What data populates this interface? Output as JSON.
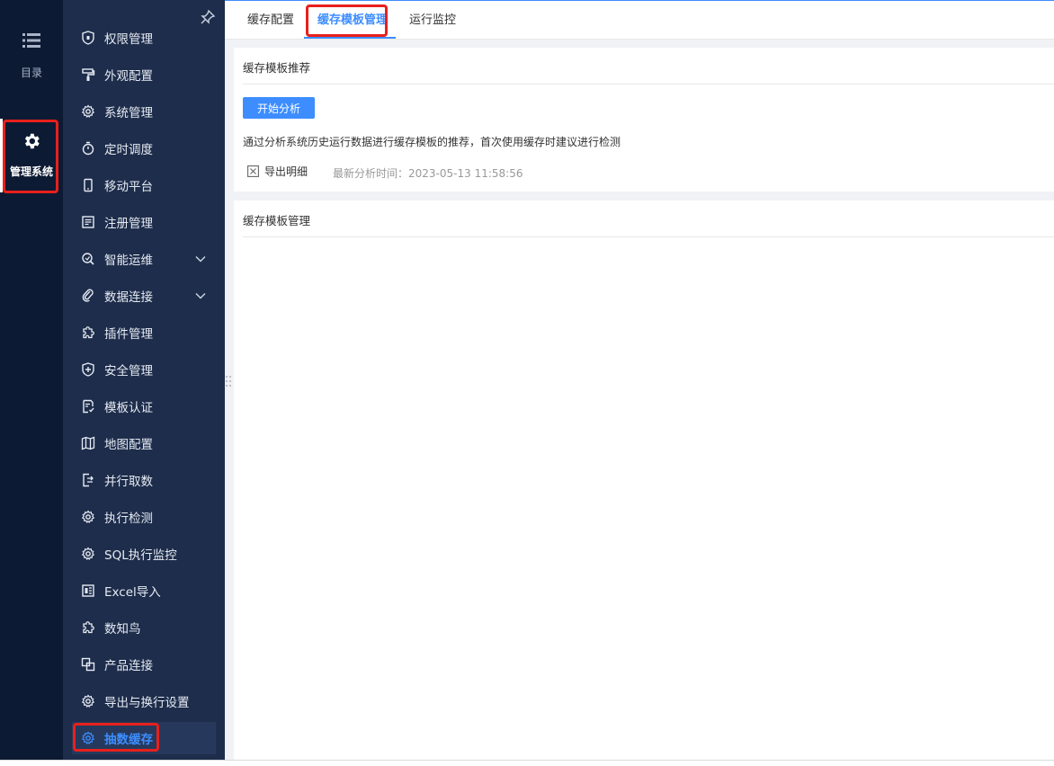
{
  "rail": {
    "catalog_label": "目录",
    "admin_label": "管理系统"
  },
  "sidebar": {
    "items": [
      {
        "label": "权限管理",
        "icon": "permission-icon"
      },
      {
        "label": "外观配置",
        "icon": "paint-roller-icon"
      },
      {
        "label": "系统管理",
        "icon": "gear-icon"
      },
      {
        "label": "定时调度",
        "icon": "timer-icon"
      },
      {
        "label": "移动平台",
        "icon": "mobile-icon"
      },
      {
        "label": "注册管理",
        "icon": "register-icon"
      },
      {
        "label": "智能运维",
        "icon": "smart-ops-icon"
      },
      {
        "label": "数据连接",
        "icon": "link-icon"
      },
      {
        "label": "插件管理",
        "icon": "puzzle-icon"
      },
      {
        "label": "安全管理",
        "icon": "shield-icon"
      },
      {
        "label": "模板认证",
        "icon": "template-cert-icon"
      },
      {
        "label": "地图配置",
        "icon": "map-icon"
      },
      {
        "label": "并行取数",
        "icon": "parallel-fetch-icon"
      },
      {
        "label": "执行检测",
        "icon": "gear-icon"
      },
      {
        "label": "SQL执行监控",
        "icon": "gear-icon"
      },
      {
        "label": "Excel导入",
        "icon": "excel-icon"
      },
      {
        "label": "数知鸟",
        "icon": "puzzle-icon"
      },
      {
        "label": "产品连接",
        "icon": "product-link-icon"
      },
      {
        "label": "导出与换行设置",
        "icon": "gear-icon"
      },
      {
        "label": "抽数缓存",
        "icon": "gear-icon"
      }
    ]
  },
  "tabs": [
    {
      "label": "缓存配置"
    },
    {
      "label": "缓存模板管理"
    },
    {
      "label": "运行监控"
    }
  ],
  "recommend": {
    "title": "缓存模板推荐",
    "start_button": "开始分析",
    "description": "通过分析系统历史运行数据进行缓存模板的推荐，首次使用缓存时建议进行检测",
    "export_label": "导出明细",
    "last_time_label": "最新分析时间：",
    "last_time_value": "2023-05-13 11:58:56"
  },
  "management": {
    "title": "缓存模板管理"
  },
  "colors": {
    "accent": "#3d8dff",
    "highlight": "#e8201c",
    "rail_bg": "#0d1a33",
    "sidebar_bg": "#1e2d4b"
  }
}
